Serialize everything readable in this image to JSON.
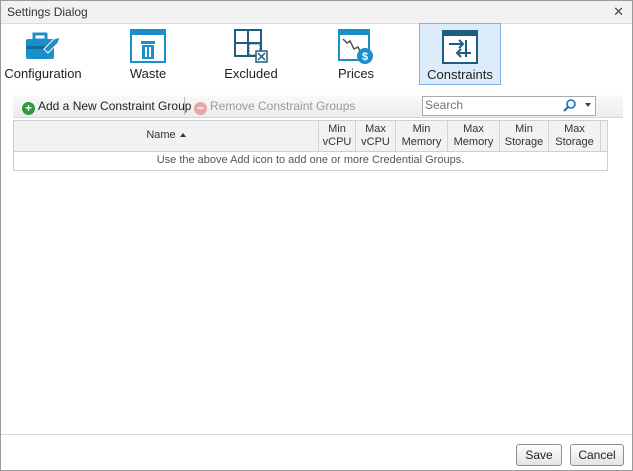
{
  "window": {
    "title": "Settings Dialog",
    "close_glyph": "✕"
  },
  "tabs": [
    {
      "label": "Configuration",
      "icon": "briefcase-wrench-icon",
      "active": false
    },
    {
      "label": "Waste",
      "icon": "trash-window-icon",
      "active": false
    },
    {
      "label": "Excluded",
      "icon": "excluded-grid-icon",
      "active": false
    },
    {
      "label": "Prices",
      "icon": "price-chart-icon",
      "active": false
    },
    {
      "label": "Constraints",
      "icon": "constraints-arrows-icon",
      "active": true
    }
  ],
  "toolbar": {
    "add_label": "Add a New Constraint Group",
    "add_glyph": "+",
    "remove_label": "Remove Constraint Groups",
    "remove_glyph": "−",
    "search_placeholder": "Search"
  },
  "grid": {
    "columns": [
      {
        "line1": "Name",
        "line2": ""
      },
      {
        "line1": "Min",
        "line2": "vCPU"
      },
      {
        "line1": "Max",
        "line2": "vCPU"
      },
      {
        "line1": "Min",
        "line2": "Memory"
      },
      {
        "line1": "Max",
        "line2": "Memory"
      },
      {
        "line1": "Min",
        "line2": "Storage"
      },
      {
        "line1": "Max",
        "line2": "Storage"
      }
    ],
    "empty_message": "Use the above Add icon to add one or more Credential Groups."
  },
  "footer": {
    "save_label": "Save",
    "cancel_label": "Cancel"
  },
  "colors": {
    "accent": "#1b8fc9",
    "active_tab_bg": "#dcecfb",
    "add_green": "#2d9a3b"
  }
}
